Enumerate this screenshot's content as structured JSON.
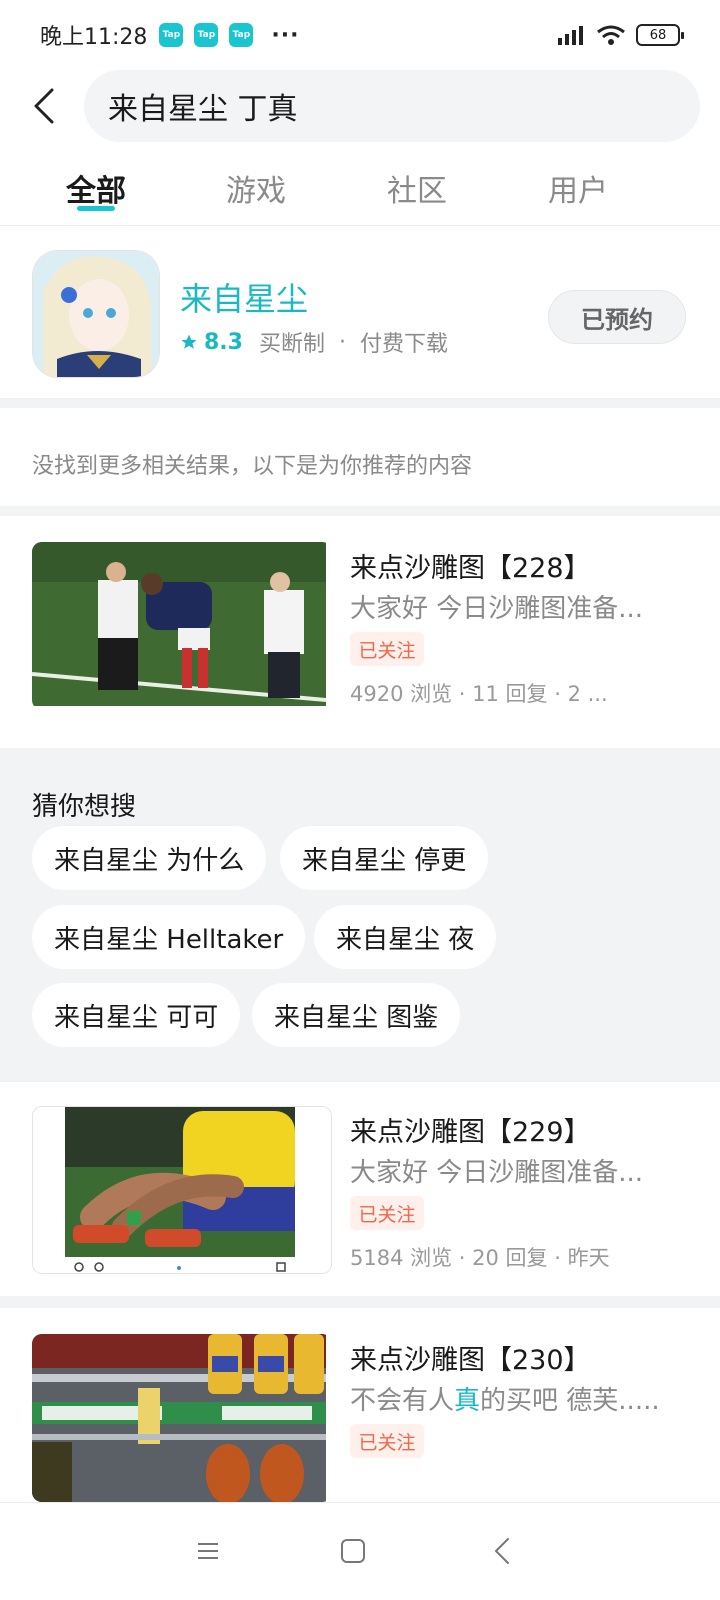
{
  "status_bar": {
    "time": "晚上11:28",
    "tap_badge": "Tap",
    "dots": "···",
    "battery": "68"
  },
  "search": {
    "query": "来自星尘 丁真"
  },
  "tabs": [
    {
      "label": "全部",
      "active": true
    },
    {
      "label": "游戏",
      "active": false
    },
    {
      "label": "社区",
      "active": false
    },
    {
      "label": "用户",
      "active": false
    }
  ],
  "game": {
    "title": "来自星尘",
    "rating": "8.3",
    "tag1": "买断制",
    "separator": "·",
    "tag2": "付费下载",
    "button": "已预约"
  },
  "notice": "没找到更多相关结果，以下是为你推荐的内容",
  "posts": [
    {
      "title": "来点沙雕图【228】",
      "excerpt": "大家好 今日沙雕图准备...",
      "badge": "已关注",
      "stats": "4920 浏览 · 11 回复 · 2 ..."
    },
    {
      "title": "来点沙雕图【229】",
      "excerpt": "大家好 今日沙雕图准备...",
      "badge": "已关注",
      "stats": "5184 浏览 · 20 回复 · 昨天"
    },
    {
      "title": "来点沙雕图【230】",
      "excerpt_pre": "不会有人",
      "excerpt_hl": "真",
      "excerpt_post": "的买吧 德芙.....",
      "badge": "已关注"
    }
  ],
  "suggestions": {
    "title": "猜你想搜",
    "chips": [
      "来自星尘 为什么",
      "来自星尘 停更",
      "来自星尘 Helltaker",
      "来自星尘 夜",
      "来自星尘 可可",
      "来自星尘 图鉴"
    ]
  },
  "colors": {
    "accent": "#19c6cf",
    "follow": "#f2664a"
  }
}
